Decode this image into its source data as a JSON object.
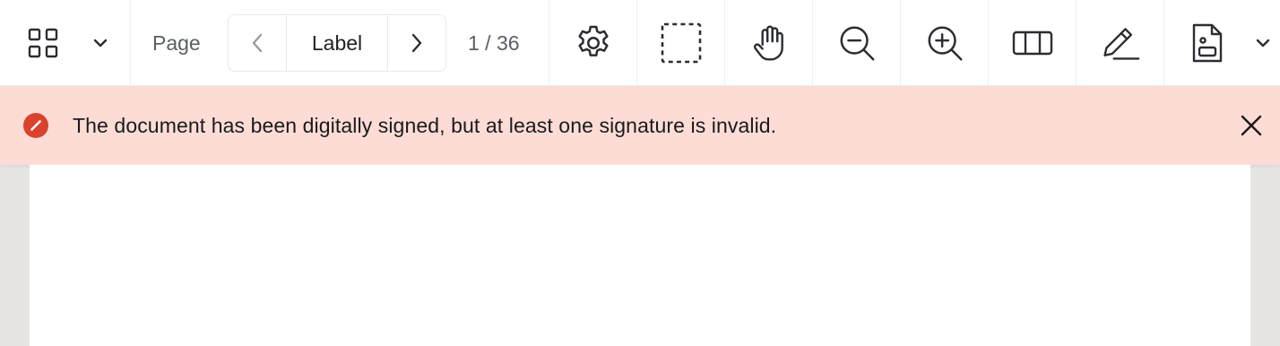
{
  "toolbar": {
    "thumbnails_icon": "grid-icon",
    "thumbnails_menu_icon": "chevron-down-icon",
    "page_label": "Page",
    "page_nav": {
      "prev_icon": "chevron-left-icon",
      "current_label": "Label",
      "next_icon": "chevron-right-icon"
    },
    "page_count": "1 / 36",
    "tools": [
      {
        "name": "settings",
        "icon": "gear-icon"
      },
      {
        "name": "marquee-select",
        "icon": "dashed-square-icon"
      },
      {
        "name": "pan",
        "icon": "hand-icon"
      },
      {
        "name": "zoom-out",
        "icon": "zoom-out-icon"
      },
      {
        "name": "zoom-in",
        "icon": "zoom-in-icon"
      },
      {
        "name": "layout",
        "icon": "columns-icon"
      },
      {
        "name": "annotate",
        "icon": "pencil-icon"
      },
      {
        "name": "document-info",
        "icon": "document-icon"
      }
    ],
    "more_menu_icon": "chevron-down-icon"
  },
  "alert": {
    "type": "error",
    "icon": "error-circle-icon",
    "message": "The document has been digitally signed, but at least one signature is invalid.",
    "close_icon": "close-icon"
  },
  "colors": {
    "alert_background": "#fddcd6",
    "alert_icon": "#d9432e",
    "toolbar_background": "#ffffff",
    "viewer_background": "#e6e5e3"
  }
}
